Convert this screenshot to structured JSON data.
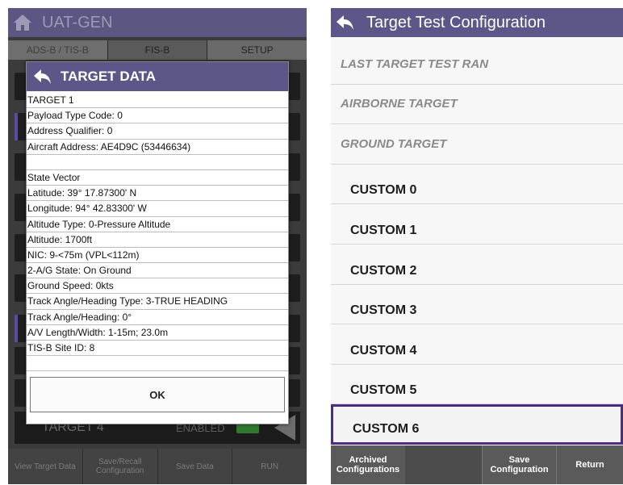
{
  "left": {
    "title": "UAT-GEN",
    "tabs": [
      "ADS-B / TIS-B",
      "FIS-B",
      "SETUP"
    ],
    "dialog": {
      "title": "TARGET DATA",
      "rows": [
        "TARGET 1",
        "Payload Type Code: 0",
        "Address Qualifier:  0",
        "Aircraft Address:  AE4D9C (53446634)",
        "",
        "State Vector",
        "Latitude:  39° 17.87300' N",
        "Longitude:  94° 42.83300' W",
        "Altitude Type:  0-Pressure Altitude",
        "Altitude:  1700ft",
        "NIC:  9-<75m (VPL<112m)",
        "2-A/G State:  On Ground",
        "Ground Speed:  0kts",
        "Track Angle/Heading Type:  3-TRUE HEADING",
        "Track Angle/Heading:  0°",
        "A/V Length/Width:  1-15m; 23.0m",
        "TIS-B Site ID:  8",
        ""
      ],
      "ok_label": "OK"
    },
    "target4": {
      "label": "TARGET 4",
      "enabled_label": "ENABLED",
      "indicator_color": "#2f7a2f"
    },
    "bottom_buttons": [
      "View Target Data",
      "Save/Recall Configuration",
      "Save Data",
      "RUN"
    ],
    "icons": {
      "home": "home-icon",
      "back": "back-arrow-icon"
    }
  },
  "right": {
    "title": "Target Test Configuration",
    "sections": [
      "LAST TARGET TEST RAN",
      "AIRBORNE TARGET",
      "GROUND TARGET"
    ],
    "customs": [
      "CUSTOM 0",
      "CUSTOM 1",
      "CUSTOM 2",
      "CUSTOM 3",
      "CUSTOM 4",
      "CUSTOM 5",
      "CUSTOM 6"
    ],
    "selected_custom": "CUSTOM 6",
    "bottom_buttons": {
      "archived": "Archived Configurations",
      "blank": "",
      "save": "Save Configuration",
      "return": "Return"
    },
    "accent_color": "#5c5788",
    "selection_color": "#4a2e82"
  }
}
